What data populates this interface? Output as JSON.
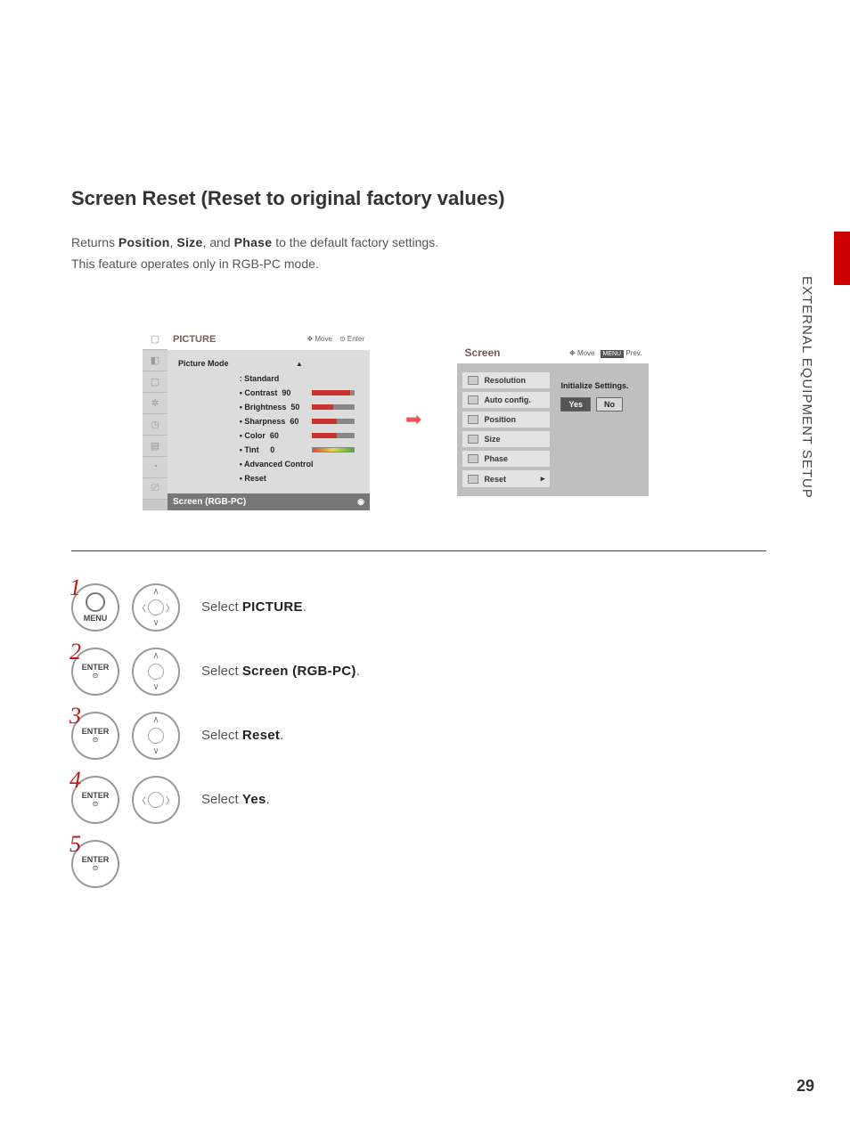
{
  "page": {
    "side_label": "EXTERNAL EQUIPMENT SETUP",
    "number": "29"
  },
  "title": "Screen Reset (Reset to original factory values)",
  "intro": {
    "prefix": "Returns ",
    "b1": "Position",
    "sep1": ", ",
    "b2": "Size",
    "sep2": ", and ",
    "b3": "Phase",
    "suffix": " to the default factory settings.",
    "line2": "This feature operates only in RGB-PC mode."
  },
  "osd_picture": {
    "title": "PICTURE",
    "hint_move": "Move",
    "hint_enter": "Enter",
    "mode_label": "Picture Mode",
    "mode_value": ": Standard",
    "rows": [
      {
        "label": "• Contrast",
        "value": "90",
        "pct": 90
      },
      {
        "label": "• Brightness",
        "value": "50",
        "pct": 50
      },
      {
        "label": "• Sharpness",
        "value": "60",
        "pct": 60
      },
      {
        "label": "• Color",
        "value": "60",
        "pct": 60
      }
    ],
    "tint_label": "• Tint",
    "tint_value": "0",
    "adv_label": "• Advanced Control",
    "reset_label": "• Reset",
    "footer": "Screen (RGB-PC)"
  },
  "osd_screen": {
    "title": "Screen",
    "hint_move": "Move",
    "hint_prev_tag": "MENU",
    "hint_prev": "Prev.",
    "items": [
      "Resolution",
      "Auto config.",
      "Position",
      "Size",
      "Phase",
      "Reset"
    ],
    "prompt": "Initialize Settings.",
    "yes": "Yes",
    "no": "No"
  },
  "steps": [
    {
      "n": "1",
      "btn": "MENU",
      "pad": "full",
      "pre": "Select ",
      "bold": "PICTURE",
      "post": "."
    },
    {
      "n": "2",
      "btn": "ENTER",
      "pad": "ud",
      "pre": "Select ",
      "bold": "Screen (RGB-PC)",
      "post": "."
    },
    {
      "n": "3",
      "btn": "ENTER",
      "pad": "ud",
      "pre": "Select ",
      "bold": "Reset",
      "post": "."
    },
    {
      "n": "4",
      "btn": "ENTER",
      "pad": "lr",
      "pre": "Select ",
      "bold": "Yes",
      "post": "."
    },
    {
      "n": "5",
      "btn": "ENTER",
      "pad": "",
      "pre": "",
      "bold": "",
      "post": ""
    }
  ],
  "chart_data": {
    "type": "bar",
    "title": "Picture Mode sliders",
    "categories": [
      "Contrast",
      "Brightness",
      "Sharpness",
      "Color",
      "Tint"
    ],
    "values": [
      90,
      50,
      60,
      60,
      0
    ],
    "ylim": [
      0,
      100
    ]
  }
}
